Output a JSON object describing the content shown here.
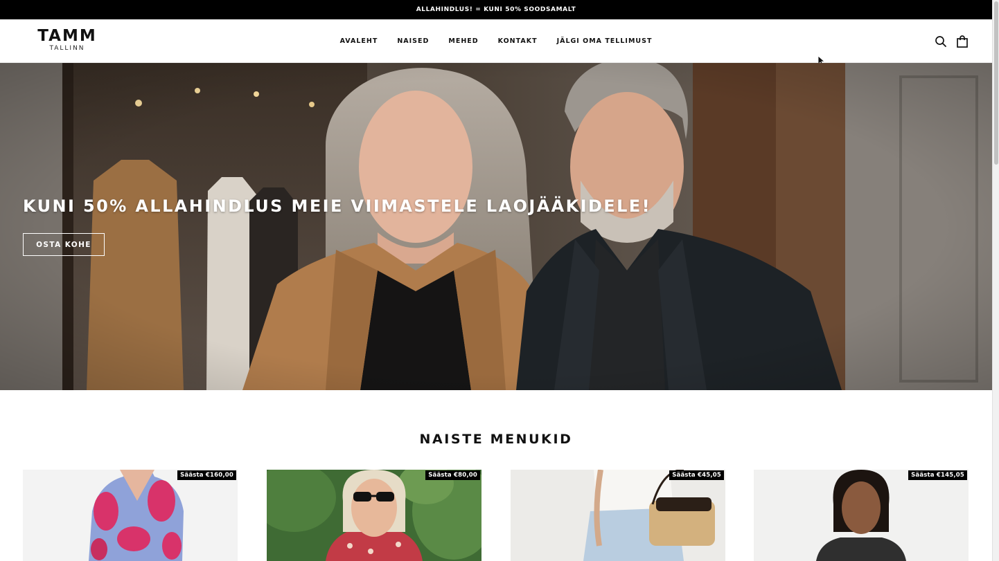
{
  "announcement": {
    "text": "ALLAHINDLUS! = KUNI 50% SOODSAMALT"
  },
  "header": {
    "logo_main": "TAMM",
    "logo_sub": "TALLINN",
    "nav": [
      "AVALEHT",
      "NAISED",
      "MEHED",
      "KONTAKT",
      "JÄLGI OMA TELLIMUST"
    ],
    "icons": [
      "search-icon",
      "shopping-bag-icon"
    ]
  },
  "hero": {
    "title": "KUNI 50% ALLAHINDLUS MEIE VIIMASTELE LAOJÄÄKIDELE!",
    "button": "OSTA KOHE"
  },
  "section": {
    "title": "NAISTE MENUKID",
    "products": [
      {
        "badge": "Säästa €160,00",
        "image": "pink-blue-wrap-dress"
      },
      {
        "badge": "Säästa €80,00",
        "image": "woman-sunglasses-floral-top"
      },
      {
        "badge": "Säästa €45,05",
        "image": "straw-handbag-light-jeans"
      },
      {
        "badge": "Säästa €145,05",
        "image": "woman-dark-top"
      }
    ]
  },
  "colors": {
    "announcement_bg": "#000000",
    "text": "#111111",
    "badge_bg": "#000000"
  }
}
